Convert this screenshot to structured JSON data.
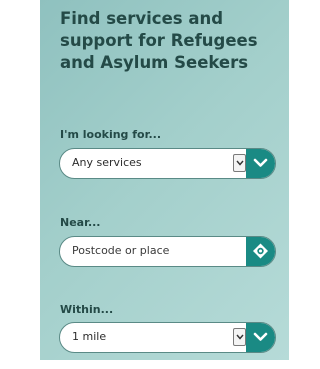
{
  "header": {
    "title": "Find services and support for Refugees and Asylum Seekers"
  },
  "filters": {
    "service": {
      "label": "I'm looking for...",
      "selected": "Any services"
    },
    "location": {
      "label": "Near...",
      "placeholder": "Postcode or place"
    },
    "distance": {
      "label": "Within...",
      "selected": "1 mile"
    }
  },
  "colors": {
    "panel_background": "#a3cfcb",
    "heading_text": "#244a47",
    "button_teal": "#1a8a84",
    "field_border": "#5a8a86"
  },
  "icons": {
    "dropdown": "chevron-down-icon",
    "locate": "crosshair-location-icon"
  }
}
